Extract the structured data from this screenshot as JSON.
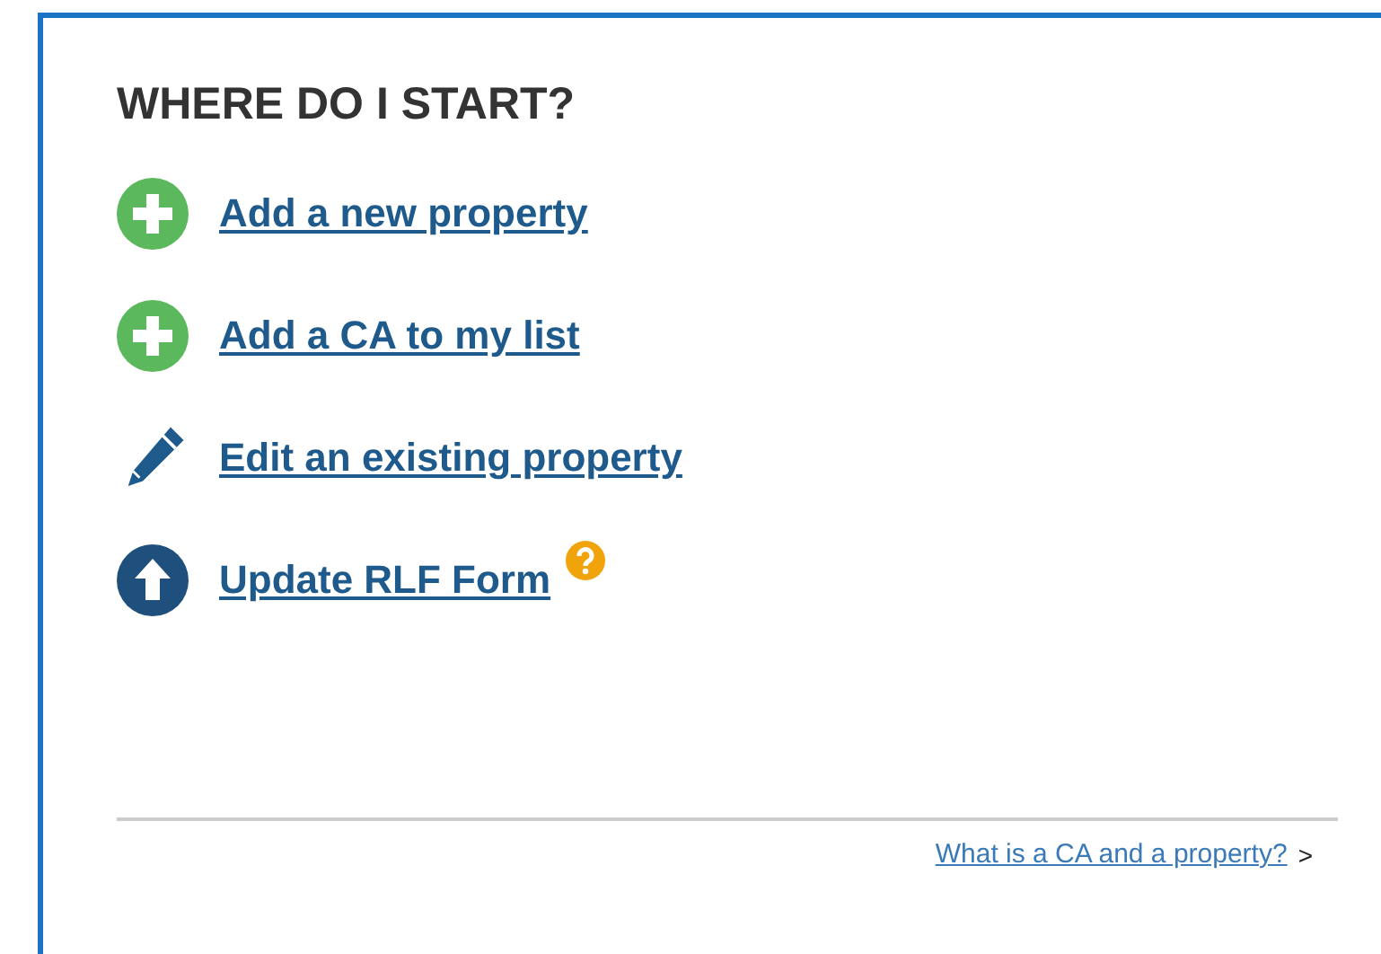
{
  "panel": {
    "title": "WHERE DO I START?",
    "actions": [
      {
        "kind": "add",
        "label": "Add a new property",
        "help": false
      },
      {
        "kind": "add",
        "label": "Add a CA to my list",
        "help": false
      },
      {
        "kind": "edit",
        "label": "Edit an existing property",
        "help": false
      },
      {
        "kind": "upload",
        "label": "Update RLF Form",
        "help": true
      }
    ],
    "footer_link": {
      "label": "What is a CA and a property?",
      "chevron": ">"
    }
  }
}
